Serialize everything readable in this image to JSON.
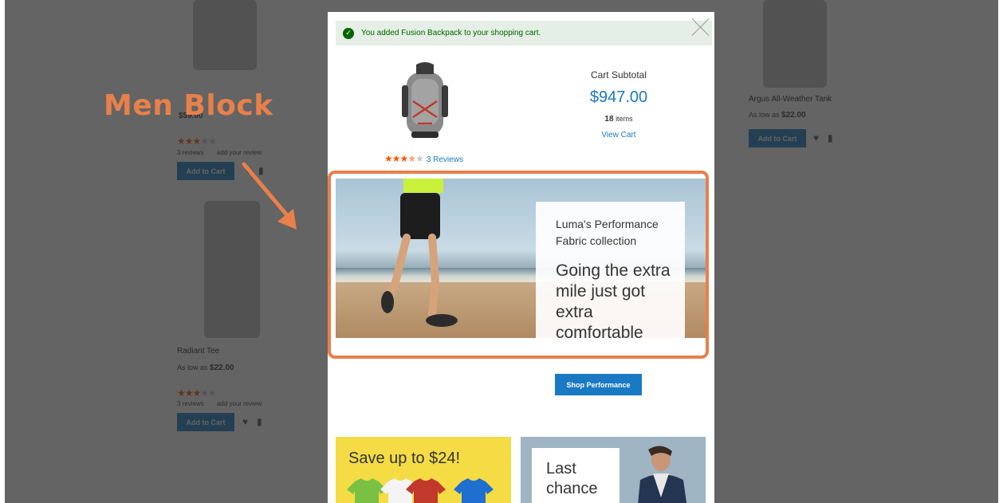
{
  "annotation": {
    "title": "Men Block",
    "color": "#e8804a"
  },
  "background_grid": {
    "products": [
      {
        "name": "Radiant Tee",
        "price_prefix": "As low as",
        "price": "$22.00",
        "rating": 3,
        "reviews": "3  reviews",
        "add_review": "add your review",
        "add_to_cart": "Add to Cart"
      },
      {
        "name": "Argus All-Weather Tank",
        "price_prefix": "As low as",
        "price": "$22.00",
        "add_to_cart": "Add to Cart"
      }
    ],
    "first_row": {
      "price": "$59.00",
      "reviews": "3  reviews",
      "add_review": "add your review",
      "add_to_cart": "Add to Cart",
      "rating": 3.5
    }
  },
  "modal": {
    "success_message": "You added Fusion Backpack to your shopping cart.",
    "product_rating": 3.5,
    "reviews_link": "3 Reviews",
    "cart": {
      "subtotal_label": "Cart Subtotal",
      "subtotal_value": "$947.00",
      "items_count": "18",
      "items_label": "items",
      "view_cart": "View Cart"
    },
    "banner": {
      "subtitle": "Luma's Performance Fabric collection",
      "headline": "Going the extra mile just got extra comfortable",
      "button": "Shop Performance"
    },
    "promo_yellow": {
      "text": "Save up to $24!"
    },
    "promo_blue": {
      "line1": "Last",
      "line2": "chance"
    }
  },
  "colors": {
    "accent_blue": "#1979c3",
    "success_green": "#006400",
    "star_orange": "#ff5501",
    "highlight_orange": "#e8804a"
  }
}
